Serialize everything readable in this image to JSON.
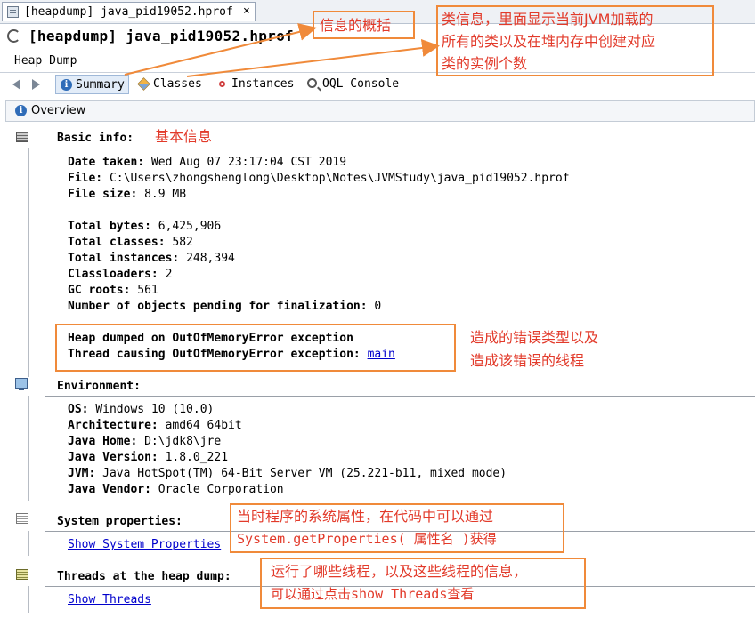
{
  "window": {
    "tab_label": "[heapdump] java_pid19052.hprof",
    "tab_close": "×",
    "title": "[heapdump] java_pid19052.hprof",
    "subtitle": "Heap Dump"
  },
  "views": {
    "summary": "Summary",
    "classes": "Classes",
    "instances": "Instances",
    "oql": "OQL Console"
  },
  "overview_label": "Overview",
  "basic": {
    "title": "Basic info:",
    "date_taken_label": "Date taken:",
    "date_taken_value": "Wed Aug 07 23:17:04 CST 2019",
    "file_label": "File:",
    "file_value": "C:\\Users\\zhongshenglong\\Desktop\\Notes\\JVMStudy\\java_pid19052.hprof",
    "file_size_label": "File size:",
    "file_size_value": "8.9 MB",
    "total_bytes_label": "Total bytes:",
    "total_bytes_value": "6,425,906",
    "total_classes_label": "Total classes:",
    "total_classes_value": "582",
    "total_instances_label": "Total instances:",
    "total_instances_value": "248,394",
    "classloaders_label": "Classloaders:",
    "classloaders_value": "2",
    "gc_roots_label": "GC roots:",
    "gc_roots_value": "561",
    "pending_label": "Number of objects pending for finalization:",
    "pending_value": "0",
    "oom_line": "Heap dumped on OutOfMemoryError exception",
    "thread_label": "Thread causing OutOfMemoryError exception:",
    "thread_link": "main"
  },
  "environment": {
    "title": "Environment:",
    "os_label": "OS:",
    "os_value": "Windows 10 (10.0)",
    "arch_label": "Architecture:",
    "arch_value": "amd64 64bit",
    "home_label": "Java Home:",
    "home_value": "D:\\jdk8\\jre",
    "version_label": "Java Version:",
    "version_value": "1.8.0_221",
    "jvm_label": "JVM:",
    "jvm_value": "Java HotSpot(TM) 64-Bit Server VM (25.221-b11, mixed mode)",
    "vendor_label": "Java Vendor:",
    "vendor_value": "Oracle Corporation"
  },
  "system_properties": {
    "title": "System properties:",
    "link": "Show System Properties"
  },
  "threads": {
    "title": "Threads at the heap dump:",
    "link": "Show Threads"
  },
  "annotations": {
    "summary_note": "信息的概括",
    "classes_note_1": "类信息，里面显示当前JVM加载的",
    "classes_note_2": "所有的类以及在堆内存中创建对应",
    "classes_note_3": "类的实例个数",
    "basic_note": "基本信息",
    "error_note_1": "造成的错误类型以及",
    "error_note_2": "造成该错误的线程",
    "sysprop_note_1": "当时程序的系统属性，在代码中可以通过",
    "sysprop_note_2": "System.getProperties( 属性名 )获得",
    "threads_note_1": "运行了哪些线程，以及这些线程的信息，",
    "threads_note_2": "可以通过点击show Threads查看"
  },
  "colors": {
    "annotation_border": "#f08a3a",
    "annotation_text": "#e23a2a",
    "link": "#0000cc"
  }
}
